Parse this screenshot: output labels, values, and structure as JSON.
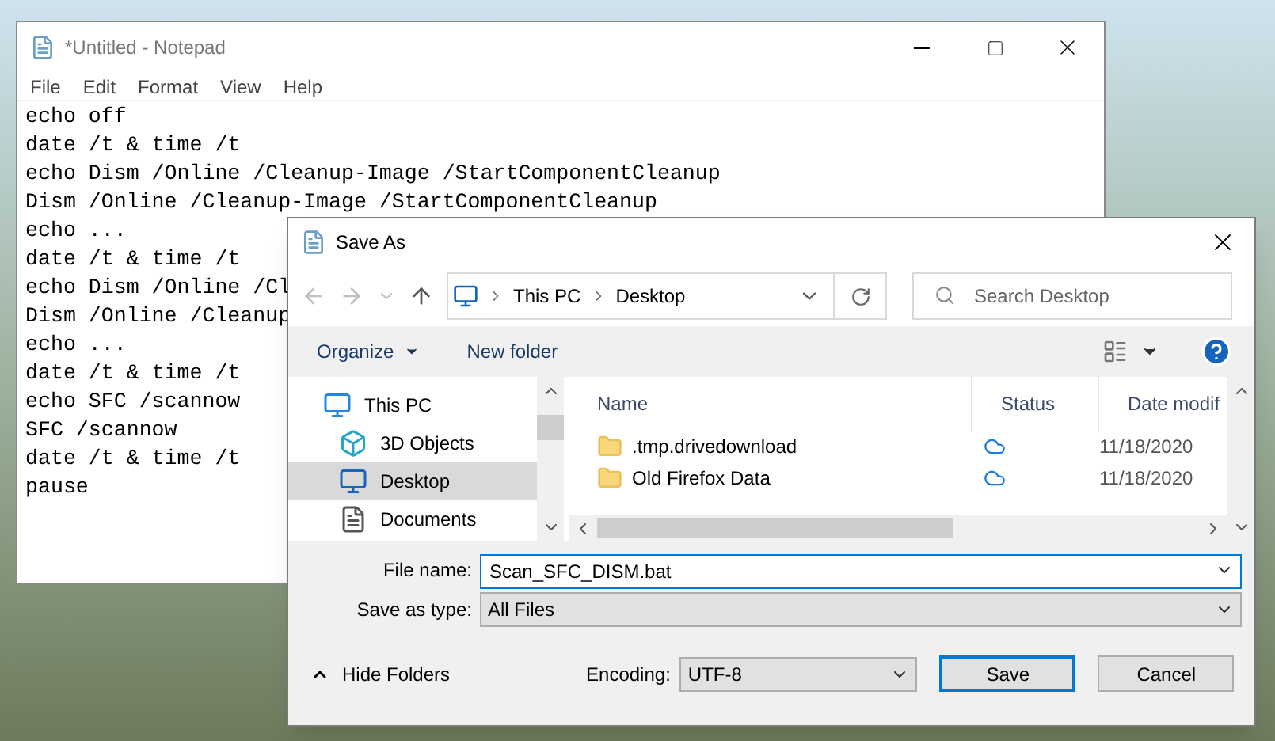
{
  "notepad": {
    "title": "*Untitled - Notepad",
    "menu": [
      "File",
      "Edit",
      "Format",
      "View",
      "Help"
    ],
    "lines": [
      "echo off",
      "date /t & time /t",
      "echo Dism /Online /Cleanup-Image /StartComponentCleanup",
      "Dism /Online /Cleanup-Image /StartComponentCleanup",
      "echo ...",
      "date /t & time /t",
      "echo Dism /Online /Cl",
      "Dism /Online /Cleanup",
      "echo ...",
      "date /t & time /t",
      "echo SFC /scannow",
      "SFC /scannow",
      "date /t & time /t",
      "pause"
    ]
  },
  "dialog": {
    "title": "Save As",
    "breadcrumb": [
      "This PC",
      "Desktop"
    ],
    "search": {
      "placeholder": "Search Desktop"
    },
    "toolbar": {
      "organize": "Organize",
      "new_folder": "New folder"
    },
    "nav_items": [
      {
        "label": "This PC",
        "kind": "pc",
        "selected": false,
        "children": [
          {
            "label": "3D Objects",
            "kind": "objects",
            "selected": false
          },
          {
            "label": "Desktop",
            "kind": "desktop",
            "selected": true
          },
          {
            "label": "Documents",
            "kind": "documents",
            "selected": false
          }
        ]
      }
    ],
    "columns": [
      "Name",
      "Status",
      "Date modif"
    ],
    "files": [
      {
        "name": ".tmp.drivedownload",
        "date": "11/18/2020"
      },
      {
        "name": "Old Firefox Data",
        "date": "11/18/2020"
      }
    ],
    "file_name": {
      "label": "File name:",
      "value": "Scan_SFC_DISM.bat"
    },
    "save_type": {
      "label": "Save as type:",
      "value": "All Files"
    },
    "hide_folders": "Hide Folders",
    "encoding": {
      "label": "Encoding:",
      "value": "UTF-8"
    },
    "buttons": [
      {
        "label": "Save",
        "default": true
      },
      {
        "label": "Cancel",
        "default": false
      }
    ]
  }
}
